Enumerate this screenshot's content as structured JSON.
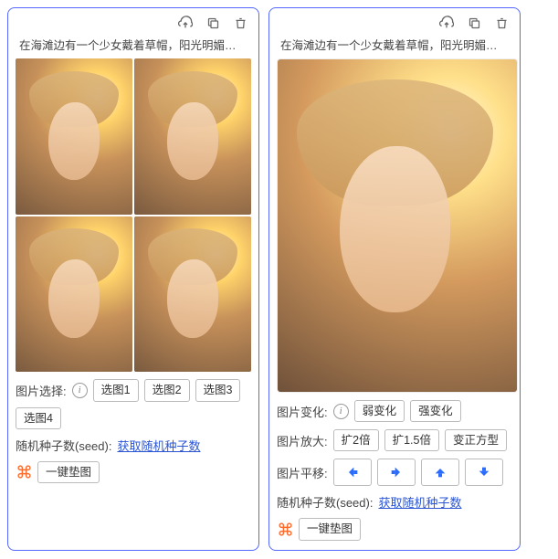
{
  "leftCard": {
    "prompt": "在海滩边有一个少女戴着草帽，阳光明媚，少女美...",
    "selectLabel": "图片选择:",
    "selectButtons": [
      "选图1",
      "选图2",
      "选图3",
      "选图4"
    ],
    "seedLabel": "随机种子数(seed):",
    "seedLink": "获取随机种子数",
    "padLabel": "一键垫图"
  },
  "rightCard": {
    "prompt": "在海滩边有一个少女戴着草帽，阳光明媚，少女美...",
    "variationLabel": "图片变化:",
    "variationButtons": [
      "弱变化",
      "强变化"
    ],
    "zoomLabel": "图片放大:",
    "zoomButtons": [
      "扩2倍",
      "扩1.5倍",
      "变正方型"
    ],
    "panLabel": "图片平移:",
    "seedLabel": "随机种子数(seed):",
    "seedLink": "获取随机种子数",
    "padLabel": "一键垫图"
  }
}
